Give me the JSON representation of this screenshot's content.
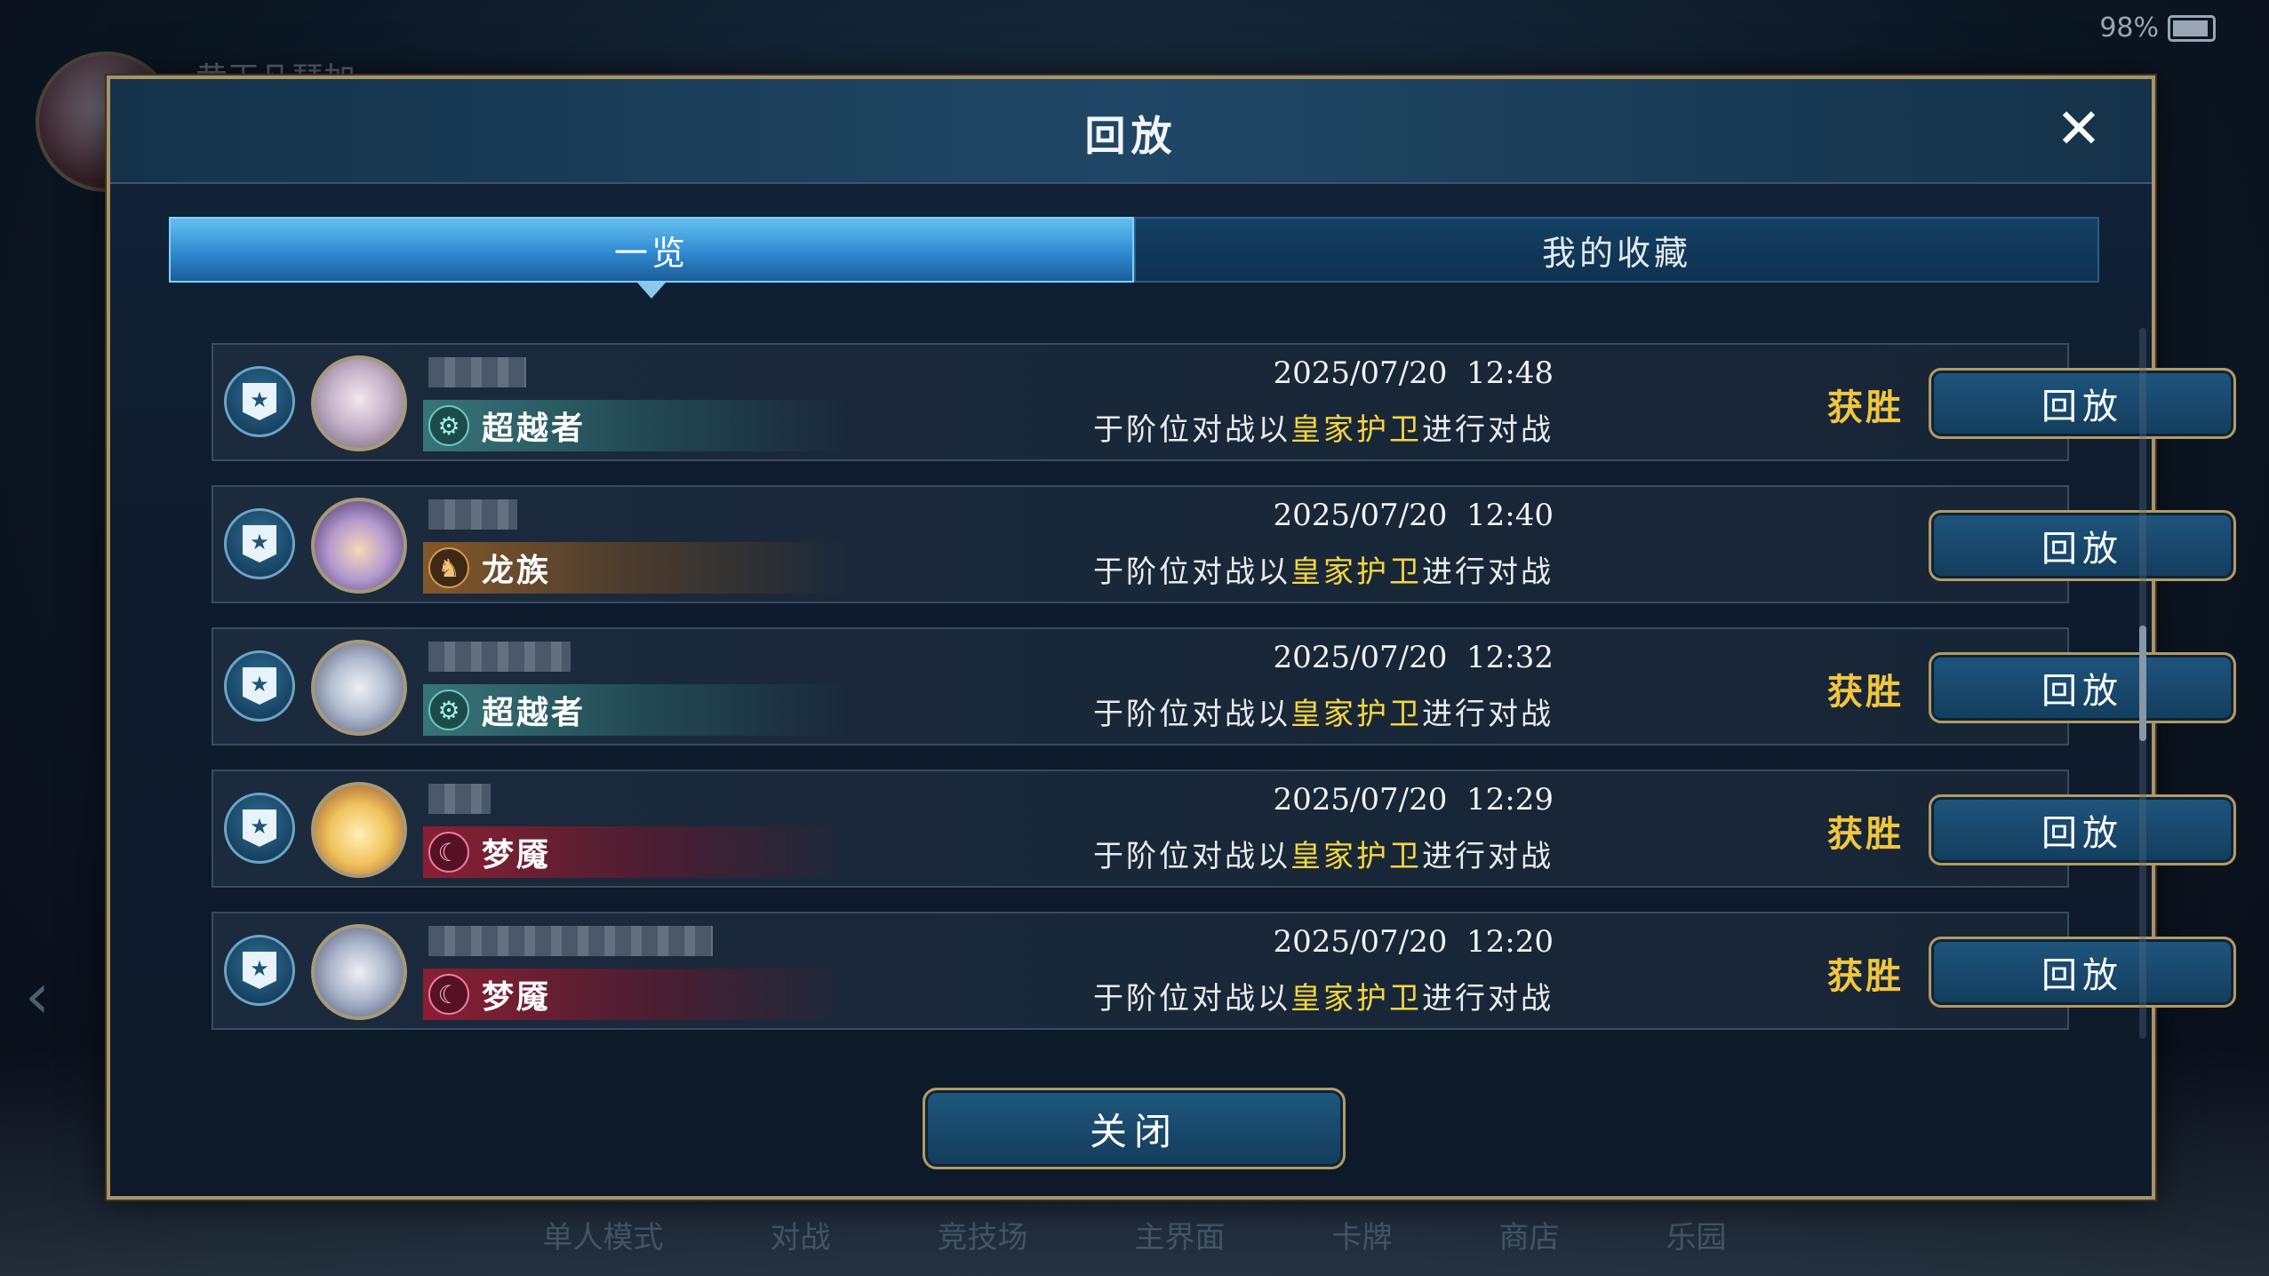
{
  "status_bar": {
    "battery": "98%"
  },
  "background": {
    "player_name": "黄玉凡瑟加",
    "nav": [
      "单人模式",
      "对战",
      "竞技场",
      "主界面",
      "卡牌",
      "商店",
      "乐园"
    ]
  },
  "dialog": {
    "title": "回放",
    "tabs": [
      {
        "label": "一览",
        "active": true
      },
      {
        "label": "我的收藏",
        "active": false
      }
    ],
    "rows": [
      {
        "datetime": "2025/07/20  12:48",
        "desc_prefix": "于阶位对战以",
        "deck": "皇家护卫",
        "desc_suffix": "进行对战",
        "class": "超越者",
        "class_color": "#3c8282",
        "result": "获胜",
        "button": "回放",
        "portrait": "silver-haired-girl",
        "name_blur_width": 110
      },
      {
        "datetime": "2025/07/20  12:40",
        "desc_prefix": "于阶位对战以",
        "deck": "皇家护卫",
        "desc_suffix": "进行对战",
        "class": "龙族",
        "class_color": "#965f28",
        "result": "",
        "button": "回放",
        "portrait": "witch-hat-girl",
        "name_blur_width": 100
      },
      {
        "datetime": "2025/07/20  12:32",
        "desc_prefix": "于阶位对战以",
        "deck": "皇家护卫",
        "desc_suffix": "进行对战",
        "class": "超越者",
        "class_color": "#3c8282",
        "result": "获胜",
        "button": "回放",
        "portrait": "white-haired-girl",
        "name_blur_width": 160
      },
      {
        "datetime": "2025/07/20  12:29",
        "desc_prefix": "于阶位对战以",
        "deck": "皇家护卫",
        "desc_suffix": "进行对战",
        "class": "梦魇",
        "class_color": "#961e32",
        "result": "获胜",
        "button": "回放",
        "portrait": "blonde-girl",
        "name_blur_width": 70
      },
      {
        "datetime": "2025/07/20  12:20",
        "desc_prefix": "于阶位对战以",
        "deck": "皇家护卫",
        "desc_suffix": "进行对战",
        "class": "梦魇",
        "class_color": "#961e32",
        "result": "获胜",
        "button": "回放",
        "portrait": "white-haired-girl",
        "name_blur_width": 320
      }
    ],
    "close_label": "关闭"
  },
  "colors": {
    "accent_gold": "#f0c640",
    "deck_yellow": "#f6d640",
    "frame_gold": "#a89369",
    "tab_active_blue": "#2f8bd0"
  }
}
